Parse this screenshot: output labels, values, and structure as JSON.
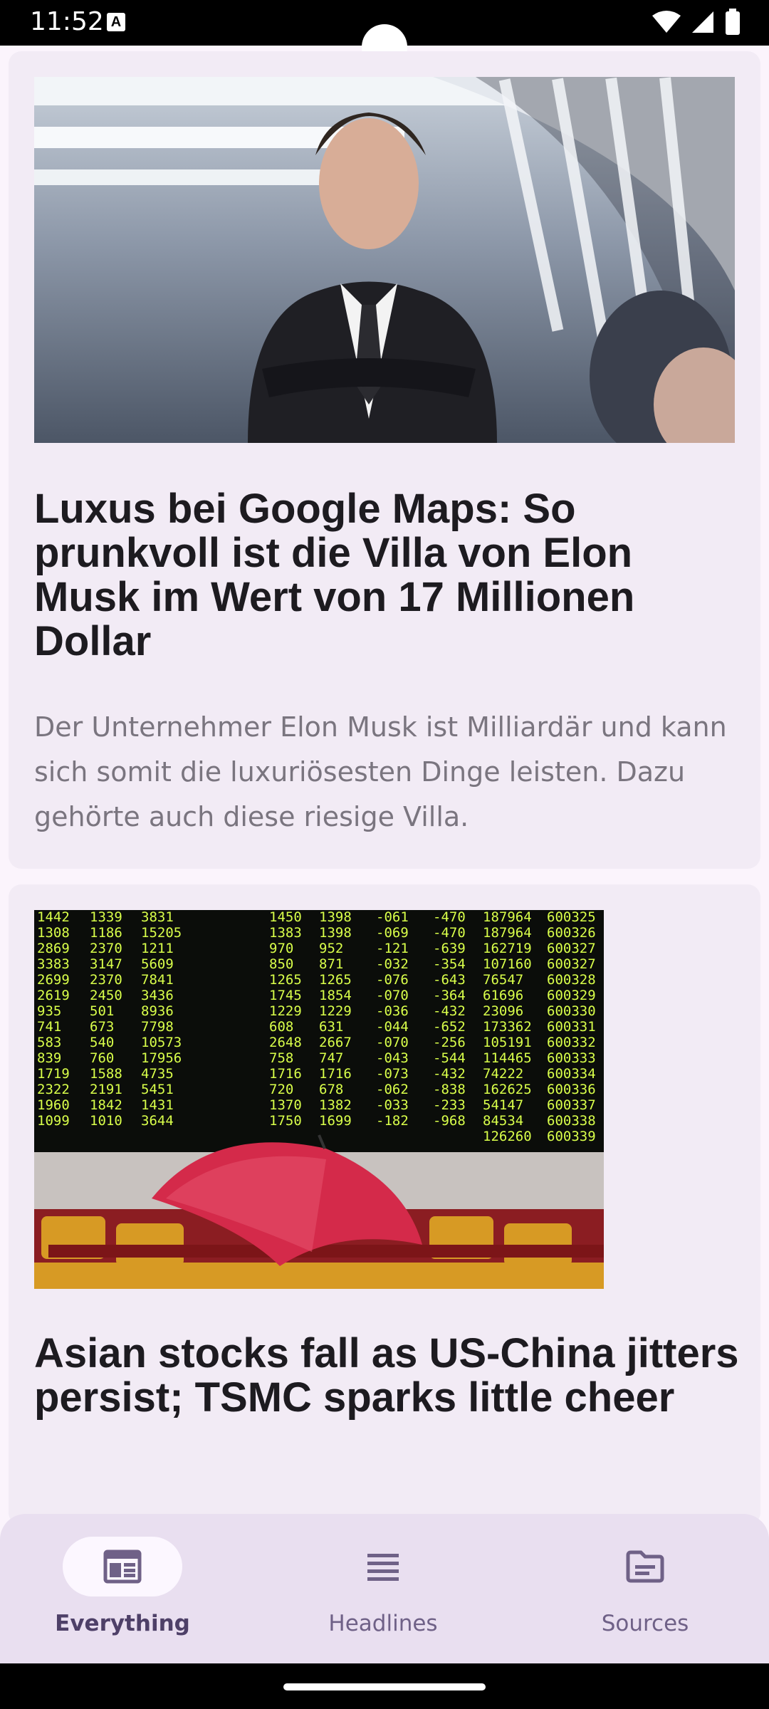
{
  "status_bar": {
    "time": "11:52",
    "notification": "A"
  },
  "articles": [
    {
      "title": "Luxus bei Google Maps: So prunkvoll ist die Villa von Elon Musk im Wert von 17 Millionen Dollar",
      "description": "Der Unternehmer Elon Musk ist Milliardär und kann sich somit die luxuriösesten Dinge leisten. Dazu gehörte auch diese riesige Villa."
    },
    {
      "title": "Asian stocks fall as US-China jitters persist; TSMC sparks little cheer"
    }
  ],
  "stock_board": {
    "rows": [
      [
        "1442",
        "1339",
        "3831",
        "1450",
        "1398",
        "-061",
        "-470",
        "187964",
        "600325"
      ],
      [
        "1308",
        "1186",
        "15205",
        "1383",
        "1398",
        "-069",
        "-470",
        "187964",
        "600326"
      ],
      [
        "2869",
        "2370",
        "1211",
        "970",
        "952",
        "-121",
        "-639",
        "162719",
        "600327"
      ],
      [
        "3383",
        "3147",
        "5609",
        "850",
        "871",
        "-032",
        "-354",
        "107160",
        "600327"
      ],
      [
        "2699",
        "2370",
        "7841",
        "1265",
        "1265",
        "-076",
        "-643",
        "76547",
        "600328"
      ],
      [
        "2619",
        "2450",
        "3436",
        "1745",
        "1854",
        "-070",
        "-364",
        "61696",
        "600329"
      ],
      [
        "935",
        "501",
        "8936",
        "1229",
        "1229",
        "-036",
        "-432",
        "23096",
        "600330"
      ],
      [
        "741",
        "673",
        "7798",
        "608",
        "631",
        "-044",
        "-652",
        "173362",
        "600331"
      ],
      [
        "583",
        "540",
        "10573",
        "2648",
        "2667",
        "-070",
        "-256",
        "105191",
        "600332"
      ],
      [
        "839",
        "760",
        "17956",
        "758",
        "747",
        "-043",
        "-544",
        "114465",
        "600333"
      ],
      [
        "1719",
        "1588",
        "4735",
        "1716",
        "1716",
        "-073",
        "-432",
        "74222",
        "600334"
      ],
      [
        "2322",
        "2191",
        "5451",
        "720",
        "678",
        "-062",
        "-838",
        "162625",
        "600336"
      ],
      [
        "1960",
        "1842",
        "1431",
        "1370",
        "1382",
        "-033",
        "-233",
        "54147",
        "600337"
      ],
      [
        "1099",
        "1010",
        "3644",
        "1750",
        "1699",
        "-182",
        "-968",
        "84534",
        "600338"
      ],
      [
        "",
        "",
        "",
        "",
        "",
        "",
        "",
        "126260",
        "600339"
      ]
    ]
  },
  "bottom_nav": {
    "items": [
      {
        "label": "Everything",
        "icon": "newspaper-icon",
        "active": true
      },
      {
        "label": "Headlines",
        "icon": "list-icon",
        "active": false
      },
      {
        "label": "Sources",
        "icon": "folder-icon",
        "active": false
      }
    ]
  },
  "colors": {
    "background": "#fbf4fc",
    "card": "#f2ebf5",
    "nav_background": "#e9dff0",
    "nav_active_pill": "#fcf7ff",
    "nav_icon": "#6f6187",
    "headline_text": "#1d1b20",
    "description_text": "#7a757f",
    "stock_board_text": "#d9ff4a"
  }
}
